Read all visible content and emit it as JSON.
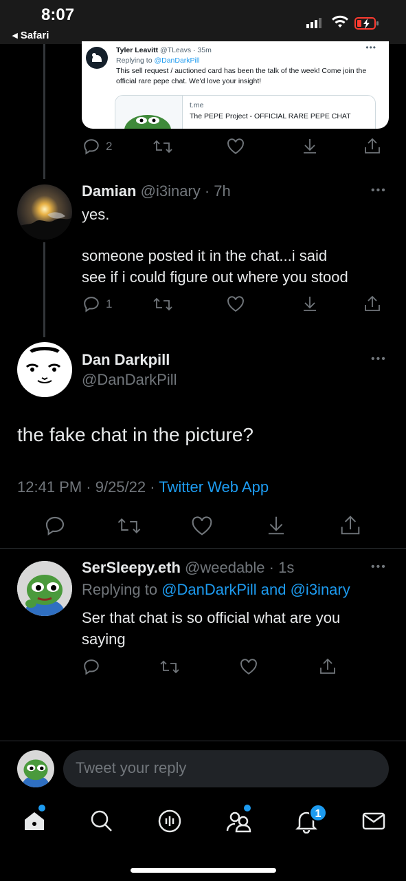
{
  "status_bar": {
    "time": "8:07",
    "back_app": "◂ Safari"
  },
  "quoted_card": {
    "author_name": "Tyler Leavitt",
    "author_handle_time": "@TLeavs · 35m",
    "replying_prefix": "Replying to ",
    "replying_to": "@DanDarkPill",
    "text": "This sell request / auctioned card has been the talk of the week! Come join the official rare pepe chat. We'd love your insight!",
    "link_domain": "t.me",
    "link_title": "The PEPE Project - OFFICIAL RARE PEPE CHAT"
  },
  "tweet_top_actions": {
    "reply_count": "2"
  },
  "damian_tweet": {
    "name": "Damian",
    "meta": "@i3inary · 7h",
    "line1": "yes.",
    "line2": "someone posted it in the chat...i said",
    "line3": "see if i could figure out where you stood",
    "reply_count": "1"
  },
  "main_tweet": {
    "name": "Dan Darkpill",
    "handle": "@DanDarkPill",
    "text": "the fake chat in the picture?",
    "timestamp": "12:41 PM · 9/25/22 · ",
    "source": "Twitter Web App"
  },
  "reply_tweet": {
    "name": "SerSleepy.eth",
    "meta": "@weedable · 1s",
    "replying_prefix": "Replying to ",
    "replying_to": "@DanDarkPill and @i3inary",
    "line1": "Ser that chat is so official what are you",
    "line2": "saying"
  },
  "reply_bar": {
    "placeholder": "Tweet your reply"
  },
  "tab_bar": {
    "notification_count": "1",
    "tabs": [
      "home-icon",
      "search-icon",
      "spaces-icon",
      "communities-icon",
      "notifications-icon",
      "messages-icon"
    ]
  },
  "colors": {
    "accent": "#1d9bf0",
    "background": "#000000",
    "muted": "#71767b"
  }
}
